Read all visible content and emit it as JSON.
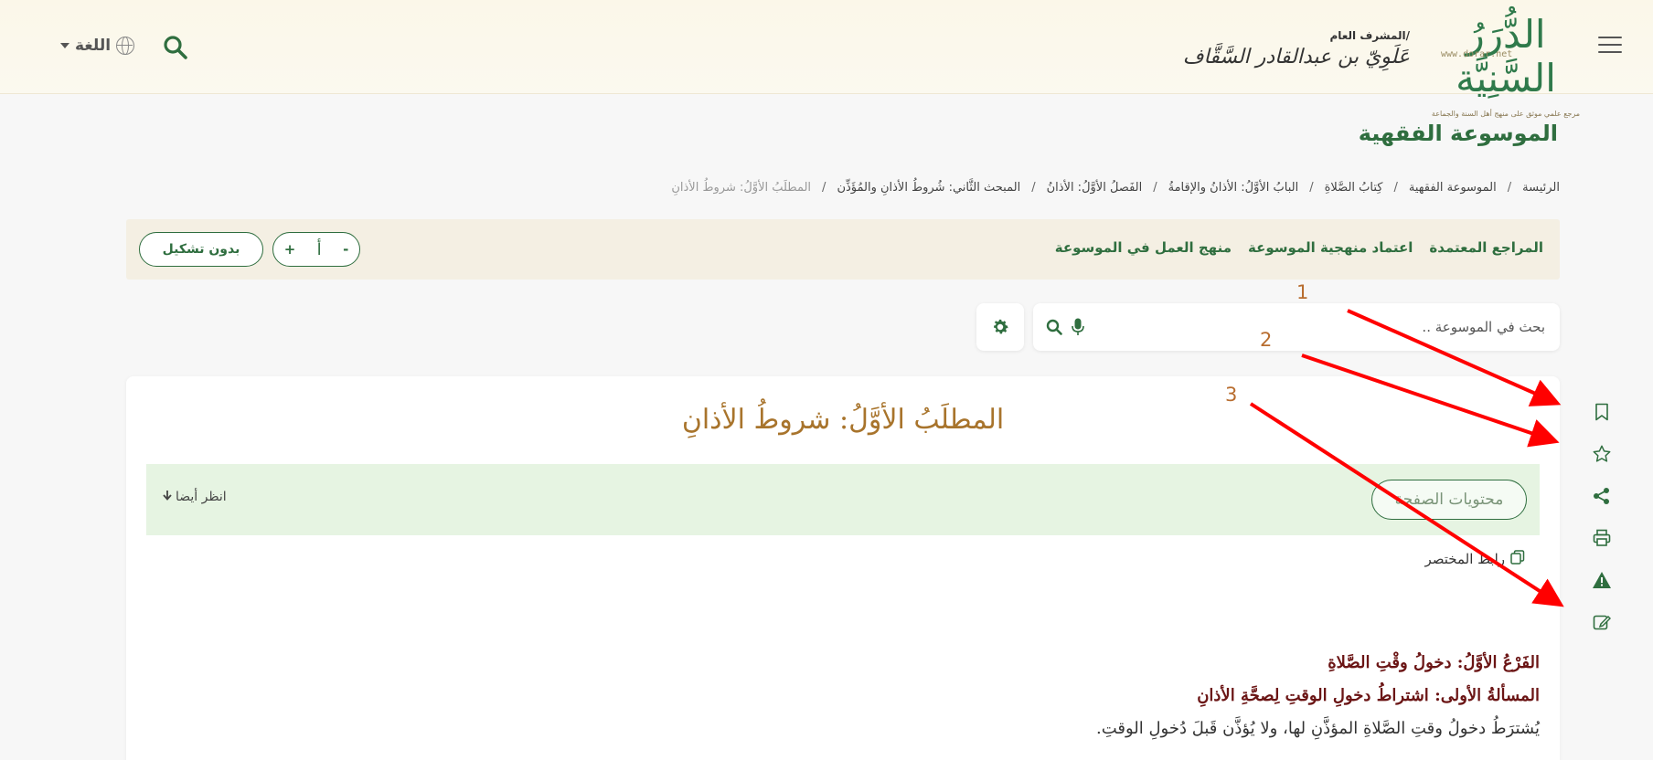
{
  "header": {
    "logo_text": "الدُّرَرُ السَّنِيَّة",
    "logo_url": "www.dorar.net",
    "logo_tagline": "مرجع علمي موثق على منهج أهل السنة والجماعة",
    "supervisor_role": "المشرف العام/",
    "supervisor_name": "عَلَوِيّ بن عبدالقادر السَّقَّاف",
    "language_label": "اللغة"
  },
  "page": {
    "title": "الموسوعة الفقهية"
  },
  "breadcrumb": [
    "الرئيسة",
    "الموسوعة الفقهية",
    "كِتابُ الصَّلاةِ",
    "البابُ الأوَّلُ: الأذانُ والإقامةُ",
    "الفَصلُ الأوَّلُ: الأذانُ",
    "المبحث الثَّاني: شُروطُ الأذانِ والمُؤَذِّن",
    "المطلَبُ الأوَّلُ: شروطُ الأذانِ"
  ],
  "links_bar": {
    "links": [
      "المراجع المعتمدة",
      "اعتماد منهجية الموسوعة",
      "منهج العمل في الموسوعة"
    ],
    "no_tashkeel_label": "بدون تشكيل",
    "font_plus": "+",
    "font_glyph": "أ",
    "font_minus": "-"
  },
  "search": {
    "placeholder": "بحث في الموسوعة .."
  },
  "annotations": [
    "1",
    "2",
    "3"
  ],
  "side_tools": [
    "bookmark-icon",
    "star-icon",
    "share-icon",
    "print-icon",
    "warning-icon",
    "edit-icon"
  ],
  "article": {
    "title": "المطلَبُ الأوَّلُ: شروطُ الأذانِ",
    "contents_button": "محتويات الصفحة",
    "see_also": "انظر أيضا",
    "short_link": "رابط المختصر",
    "section_heading": "الفَرْعُ الأوَّلُ: دخولُ وقْتِ الصَّلاةِ",
    "issue_heading": "المسألةُ الأولى: اشتراطُ دخولِ الوقتِ لِصحَّةِ الأذانِ",
    "paragraph": "يُشترَطُ دخولُ وقتِ الصَّلاةِ المؤذَّنِ لها، ولا يُؤذَّن قَبلَ دُخولِ الوقتِ."
  },
  "colors": {
    "brand_green": "#2f6e3f",
    "title_gold": "#a8742c",
    "heading_maroon": "#6b1515",
    "annotation_red": "#ff0000"
  }
}
